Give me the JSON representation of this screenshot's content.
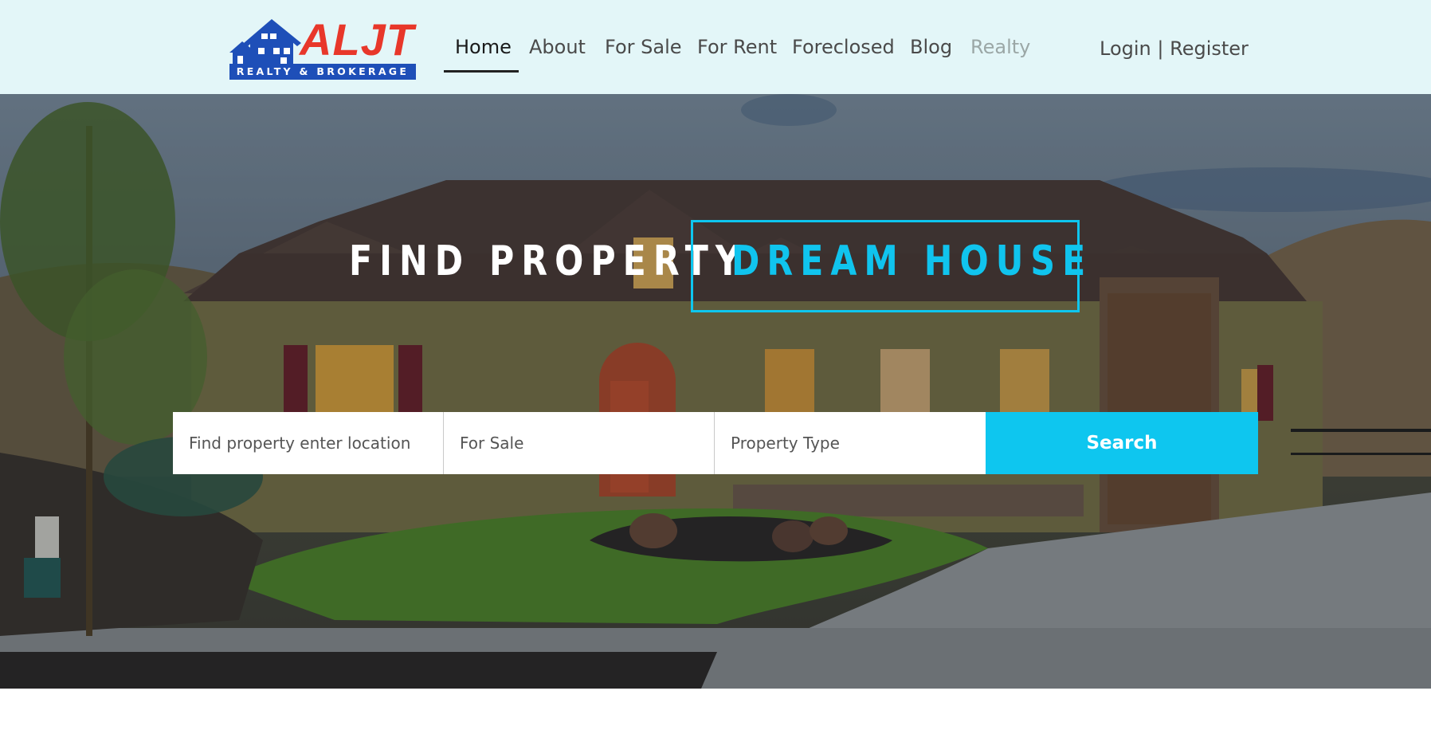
{
  "brand": {
    "name": "ALJT",
    "tagline": "REALTY & BROKERAGE",
    "colors": {
      "red": "#e8372a",
      "blue": "#1e4fb8"
    }
  },
  "nav": {
    "items": [
      {
        "label": "Home",
        "state": "active"
      },
      {
        "label": "About",
        "state": "default"
      },
      {
        "label": "For Sale",
        "state": "default"
      },
      {
        "label": "For Rent",
        "state": "default"
      },
      {
        "label": "Foreclosed",
        "state": "default"
      },
      {
        "label": "Blog",
        "state": "default"
      },
      {
        "label": "Realty",
        "state": "muted"
      }
    ],
    "auth": "Login | Register"
  },
  "hero": {
    "headline_left": "FIND PROPERTY",
    "headline_right": "DREAM HOUSE",
    "accent_color": "#0ec6ef",
    "search": {
      "location_placeholder": "Find property enter location",
      "status_value": "For Sale",
      "type_placeholder": "Property Type",
      "button_label": "Search"
    }
  }
}
